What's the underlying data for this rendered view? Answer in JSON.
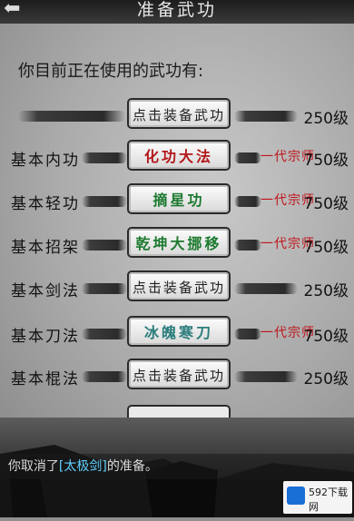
{
  "header": {
    "back": "⬅",
    "title": "准备武功"
  },
  "subtitle": "你目前正在使用的武功有:",
  "rows": [
    {
      "label": "",
      "button": "点击装备武功",
      "rank": "",
      "level": "250级"
    },
    {
      "label": "基本内功",
      "button": "化功大法",
      "rank": "一代宗师",
      "level": "750级"
    },
    {
      "label": "基本轻功",
      "button": "摘星功",
      "rank": "一代宗师",
      "level": "750级"
    },
    {
      "label": "基本招架",
      "button": "乾坤大挪移",
      "rank": "一代宗师",
      "level": "750级"
    },
    {
      "label": "基本剑法",
      "button": "点击装备武功",
      "rank": "",
      "level": "250级"
    },
    {
      "label": "基本刀法",
      "button": "冰魄寒刀",
      "rank": "一代宗师",
      "level": "750级"
    },
    {
      "label": "基本棍法",
      "button": "点击装备武功",
      "rank": "",
      "level": "250级"
    }
  ],
  "message": {
    "prefix": "你取消了",
    "skill": "[太极剑]",
    "suffix": "的准备。"
  },
  "watermark": {
    "text": "592下载网"
  },
  "colors": {
    "rank": "#c0141a",
    "skill_red": "#b3171a",
    "skill_green": "#1c7a2f",
    "skill_teal": "#2a7d7c",
    "message_skill": "#5fd0ff"
  }
}
